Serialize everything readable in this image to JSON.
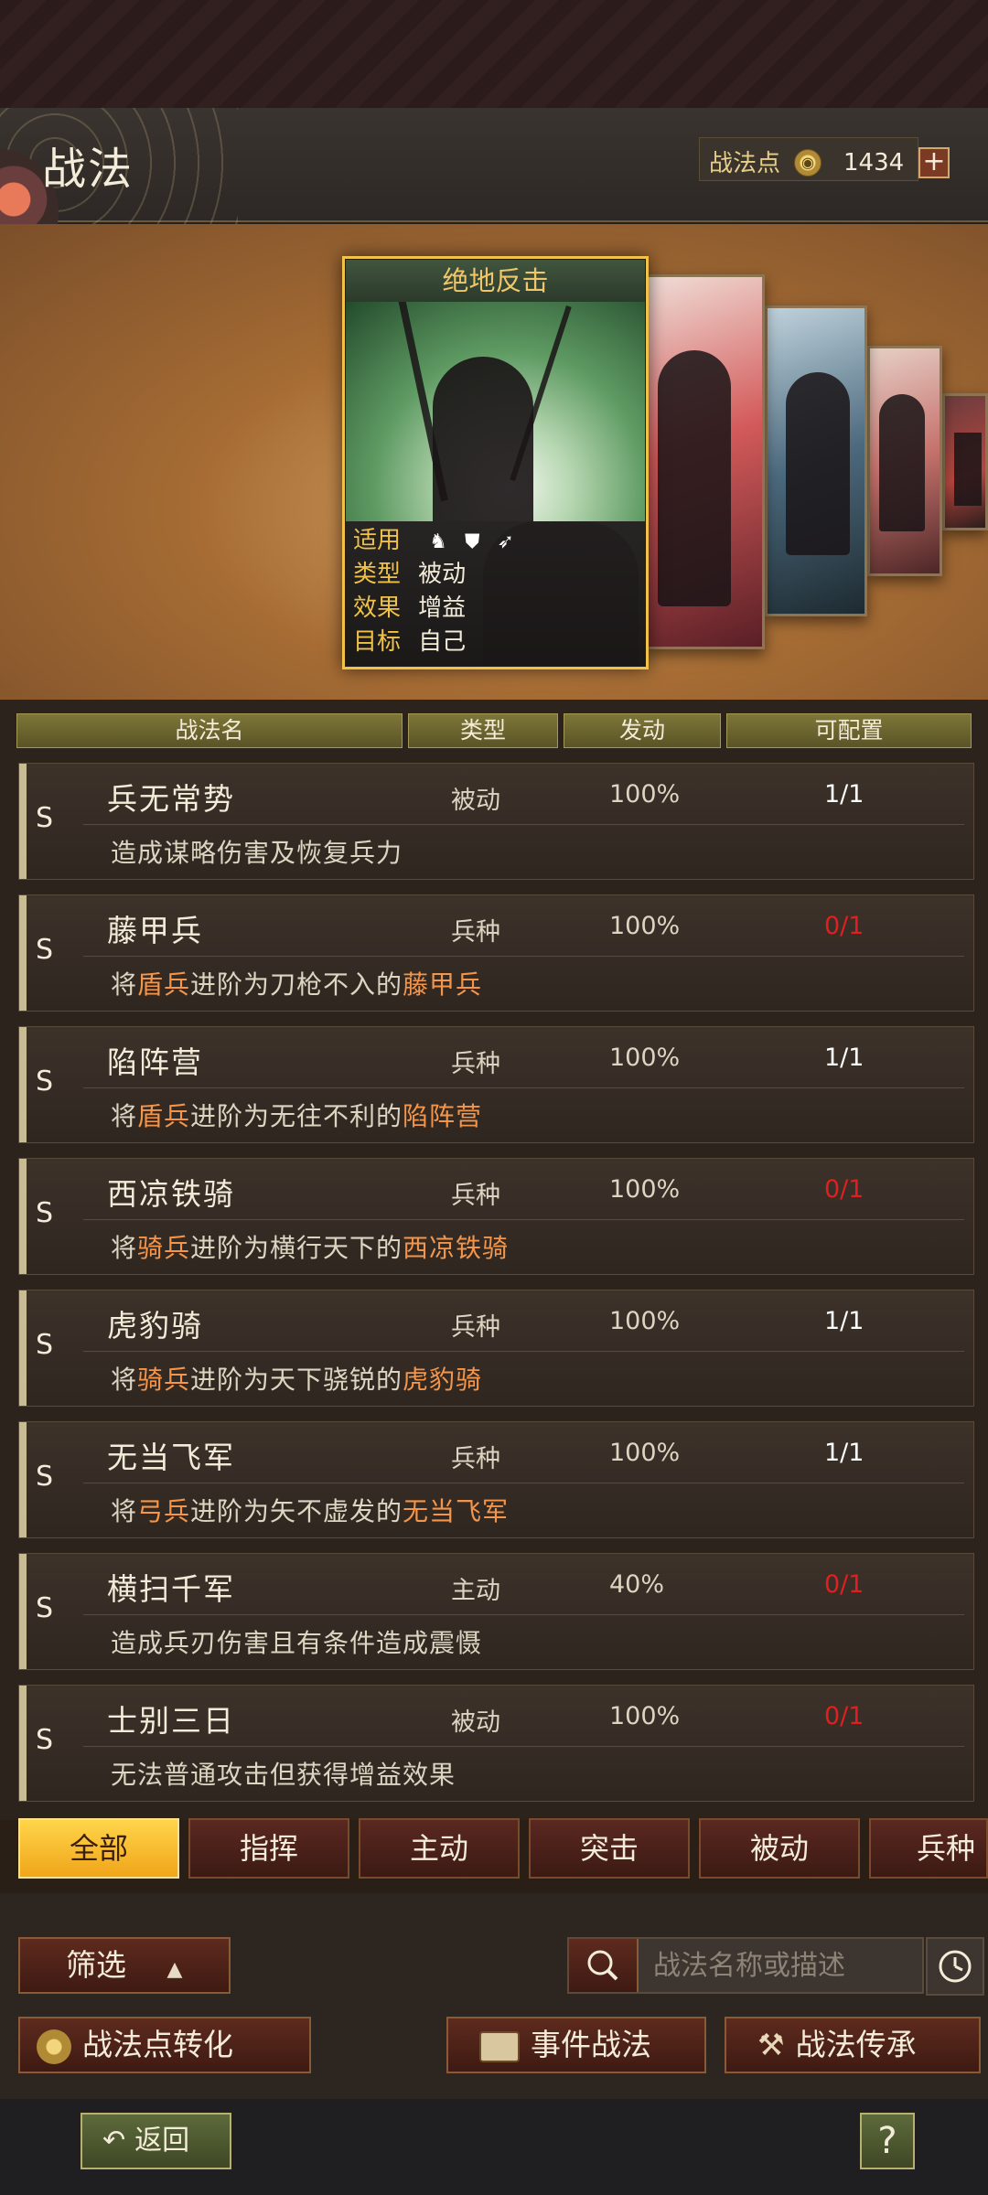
{
  "header": {
    "title": "战法",
    "points_label": "战法点",
    "points_value": "1434",
    "plus_label": "+"
  },
  "featured": {
    "title": "绝地反击",
    "info": [
      {
        "key": "适用",
        "value": ""
      },
      {
        "key": "类型",
        "value": "被动"
      },
      {
        "key": "效果",
        "value": "增益"
      },
      {
        "key": "目标",
        "value": "自己"
      }
    ],
    "troop_icons": [
      "cavalry-icon",
      "shield-icon",
      "bow-icon"
    ]
  },
  "table": {
    "columns": [
      "战法名",
      "类型",
      "发动",
      "可配置"
    ],
    "rows": [
      {
        "grade": "S",
        "name": "兵无常势",
        "type": "被动",
        "rate": "100%",
        "config": "1/1",
        "config_color": "#ffffff",
        "desc": [
          "造成谋略伤害及恢复兵力"
        ]
      },
      {
        "grade": "S",
        "name": "藤甲兵",
        "type": "兵种",
        "rate": "100%",
        "config": "0/1",
        "config_color": "#e02020",
        "desc": [
          "将",
          "盾兵",
          "进阶为刀枪不入的",
          "藤甲兵"
        ]
      },
      {
        "grade": "S",
        "name": "陷阵营",
        "type": "兵种",
        "rate": "100%",
        "config": "1/1",
        "config_color": "#ffffff",
        "desc": [
          "将",
          "盾兵",
          "进阶为无往不利的",
          "陷阵营"
        ]
      },
      {
        "grade": "S",
        "name": "西凉铁骑",
        "type": "兵种",
        "rate": "100%",
        "config": "0/1",
        "config_color": "#e02020",
        "desc": [
          "将",
          "骑兵",
          "进阶为横行天下的",
          "西凉铁骑"
        ]
      },
      {
        "grade": "S",
        "name": "虎豹骑",
        "type": "兵种",
        "rate": "100%",
        "config": "1/1",
        "config_color": "#ffffff",
        "desc": [
          "将",
          "骑兵",
          "进阶为天下骁锐的",
          "虎豹骑"
        ]
      },
      {
        "grade": "S",
        "name": "无当飞军",
        "type": "兵种",
        "rate": "100%",
        "config": "1/1",
        "config_color": "#ffffff",
        "desc": [
          "将",
          "弓兵",
          "进阶为矢不虚发的",
          "无当飞军"
        ]
      },
      {
        "grade": "S",
        "name": "横扫千军",
        "type": "主动",
        "rate": "40%",
        "config": "0/1",
        "config_color": "#e02020",
        "desc": [
          "造成兵刃伤害且有条件造成震慑"
        ]
      },
      {
        "grade": "S",
        "name": "士别三日",
        "type": "被动",
        "rate": "100%",
        "config": "0/1",
        "config_color": "#e02020",
        "desc": [
          "无法普通攻击但获得增益效果"
        ]
      }
    ]
  },
  "tabs": [
    "全部",
    "指挥",
    "主动",
    "突击",
    "被动",
    "兵种"
  ],
  "controls": {
    "filter_label": "筛选",
    "search_placeholder": "战法名称或描述",
    "convert_label": "战法点转化",
    "event_label": "事件战法",
    "inherit_label": "战法传承"
  },
  "footer": {
    "back_label": "返回",
    "help_label": "?"
  }
}
